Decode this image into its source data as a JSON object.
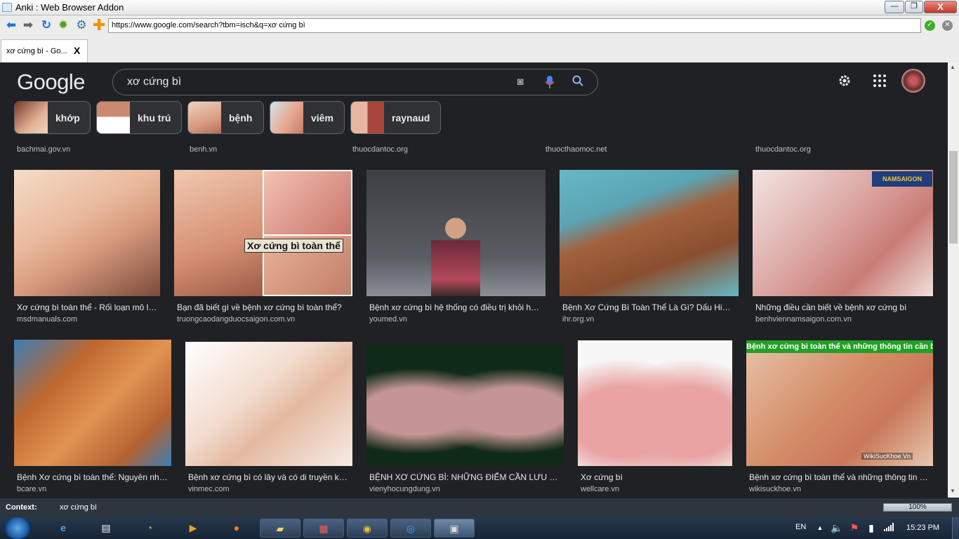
{
  "window": {
    "title": "Anki : Web Browser Addon",
    "min": "—",
    "max": "❐",
    "close": "X"
  },
  "nav": {
    "url": "https://www.google.com/search?tbm=isch&q=xơ cứng bì"
  },
  "tab": {
    "label": "xơ cứng bì - Go...",
    "close": "X"
  },
  "google": {
    "logo": "Google",
    "query": "xơ cứng bì",
    "chips": [
      {
        "label": "khớp"
      },
      {
        "label": "khu trú"
      },
      {
        "label": "bệnh"
      },
      {
        "label": "viêm"
      },
      {
        "label": "raynaud"
      }
    ]
  },
  "prev_row_sources": [
    "bachmai.gov.vn",
    "benh.vn",
    "thuocdantoc.org",
    "thuocthaomoc.net",
    "thuocdantoc.org"
  ],
  "row1": [
    {
      "caption": "Xơ cứng bì toàn thể - Rối loạn mô liên kết",
      "source": "msdmanuals.com"
    },
    {
      "caption": "Bạn đã biết gì về bệnh xơ cứng bì toàn thể?",
      "source": "truongcaodangduocsaigon.com.vn",
      "overlay": "Xơ cứng bì toàn thể"
    },
    {
      "caption": "Bệnh xơ cứng bì hệ thống có điều trị khỏi hẳn không",
      "source": "youmed.vn"
    },
    {
      "caption": "Bệnh Xơ Cứng Bì Toàn Thể Là Gì? Dấu Hiệu Nhận Biết",
      "source": "ihr.org.vn"
    },
    {
      "caption": "Những điều cần biết về bệnh xơ cứng bì",
      "source": "benhviennamsaigon.com.vn",
      "logo": "NAMSAIGON"
    }
  ],
  "row2": [
    {
      "caption": "Bệnh Xơ cứng bì toàn thể: Nguyên nhân, triệu chứng",
      "source": "bcare.vn"
    },
    {
      "caption": "Bệnh xơ cứng bì có lây và có di truyền không",
      "source": "vinmec.com"
    },
    {
      "caption": "BỆNH XƠ CỨNG BÌ: NHỮNG ĐIỂM CẦN LƯU Ý | Viện Y học",
      "source": "vienyhocungdung.vn"
    },
    {
      "caption": "Xơ cứng bì",
      "source": "wellcare.vn"
    },
    {
      "caption": "Bệnh xơ cứng bì toàn thể và những thông tin cần biết",
      "source": "wikisuckhoe.vn",
      "banner": "Bệnh xơ cứng bì toàn thể và những thông tin cần biết",
      "wm": "WikiSucKhoe.Vn"
    }
  ],
  "status": {
    "context_label": "Context:",
    "context_value": "xơ cứng bì",
    "zoom": "100%"
  },
  "taskbar": {
    "lang": "EN",
    "time": "15:23 PM"
  }
}
